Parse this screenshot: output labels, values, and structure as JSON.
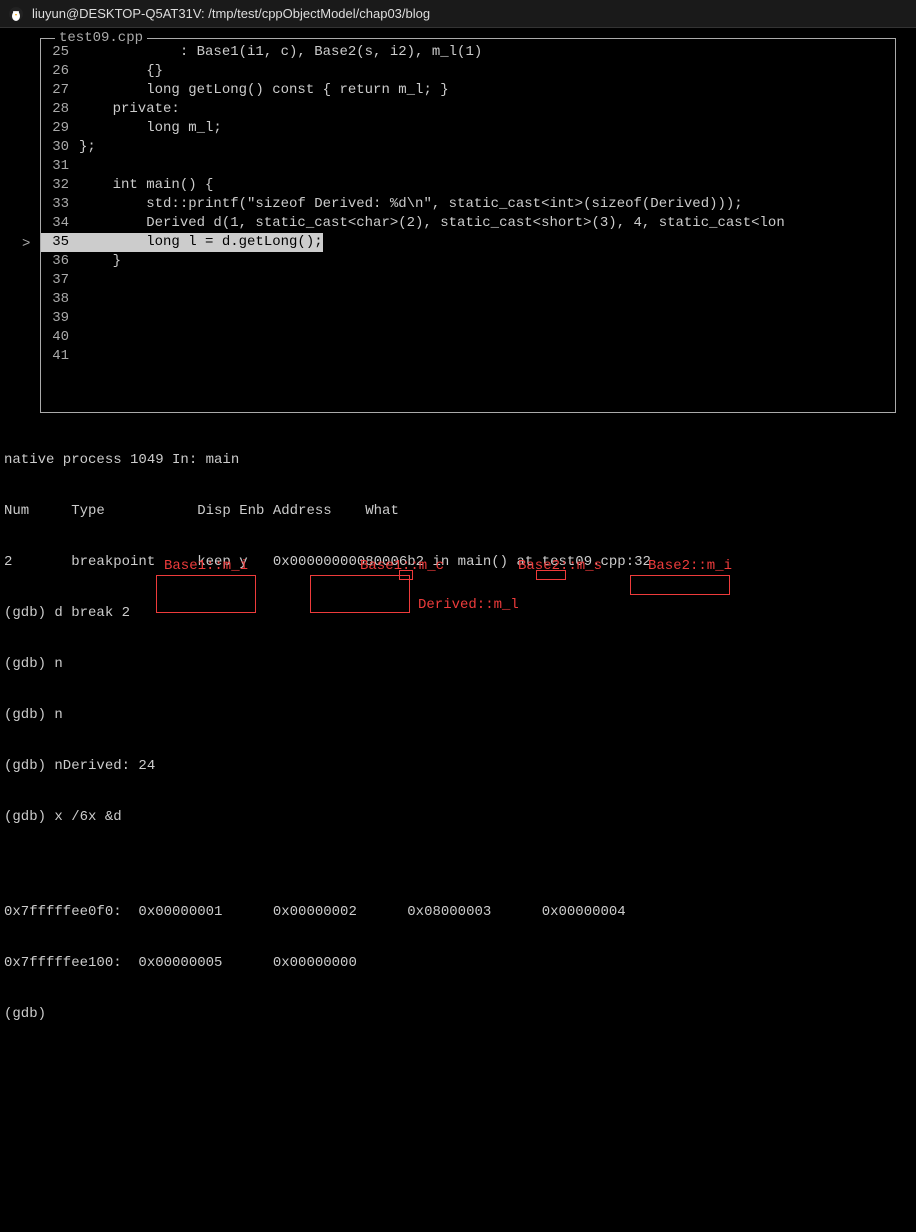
{
  "titlebar": {
    "text": "liuyun@DESKTOP-Q5AT31V: /tmp/test/cppObjectModel/chap03/blog"
  },
  "code": {
    "filename": "test09.cpp",
    "current_line_marker": ">",
    "lines": [
      {
        "n": "25",
        "t": "            : Base1(i1, c), Base2(s, i2), m_l(1)"
      },
      {
        "n": "26",
        "t": "        {}"
      },
      {
        "n": "27",
        "t": "        long getLong() const { return m_l; }"
      },
      {
        "n": "28",
        "t": "    private:"
      },
      {
        "n": "29",
        "t": "        long m_l;"
      },
      {
        "n": "30",
        "t": "};"
      },
      {
        "n": "31",
        "t": ""
      },
      {
        "n": "32",
        "t": "    int main() {"
      },
      {
        "n": "33",
        "t": "        std::printf(\"sizeof Derived: %d\\n\", static_cast<int>(sizeof(Derived)));"
      },
      {
        "n": "34",
        "t": "        Derived d(1, static_cast<char>(2), static_cast<short>(3), 4, static_cast<lon"
      },
      {
        "n": "35",
        "t": "        long l = d.getLong();",
        "current": true
      },
      {
        "n": "36",
        "t": "    }"
      },
      {
        "n": "37",
        "t": ""
      },
      {
        "n": "38",
        "t": ""
      },
      {
        "n": "39",
        "t": ""
      },
      {
        "n": "40",
        "t": ""
      },
      {
        "n": "41",
        "t": ""
      }
    ]
  },
  "gdb": {
    "status": "native process 1049 In: main",
    "header": "Num     Type           Disp Enb Address    What",
    "breakpoint": "2       breakpoint     keep y   0x00000000080006b2 in main() at test09.cpp:32",
    "cmd1": "(gdb) d break 2",
    "cmd2": "(gdb) n",
    "cmd3": "(gdb) n",
    "cmd4": "(gdb) nDerived: 24",
    "cmd5": "(gdb) x /6x &d",
    "mem1": "0x7fffffee0f0:  0x00000001      0x00000002      0x08000003      0x00000004",
    "mem2": "0x7fffffee100:  0x00000005      0x00000000",
    "prompt": "(gdb) "
  },
  "annotations": {
    "a1": "Base1::m_i",
    "a2": "Base1::m_c",
    "a3": "Base2::m_s",
    "a4": "Base2::m_i",
    "a5": "Derived::m_l"
  },
  "memory_values": {
    "addr1": "0x7fffffee0f0",
    "addr2": "0x7fffffee100",
    "v1": "0x00000001",
    "v2": "0x00000002",
    "v3": "0x08000003",
    "v4": "0x00000004",
    "v5": "0x00000005",
    "v6": "0x00000000"
  }
}
